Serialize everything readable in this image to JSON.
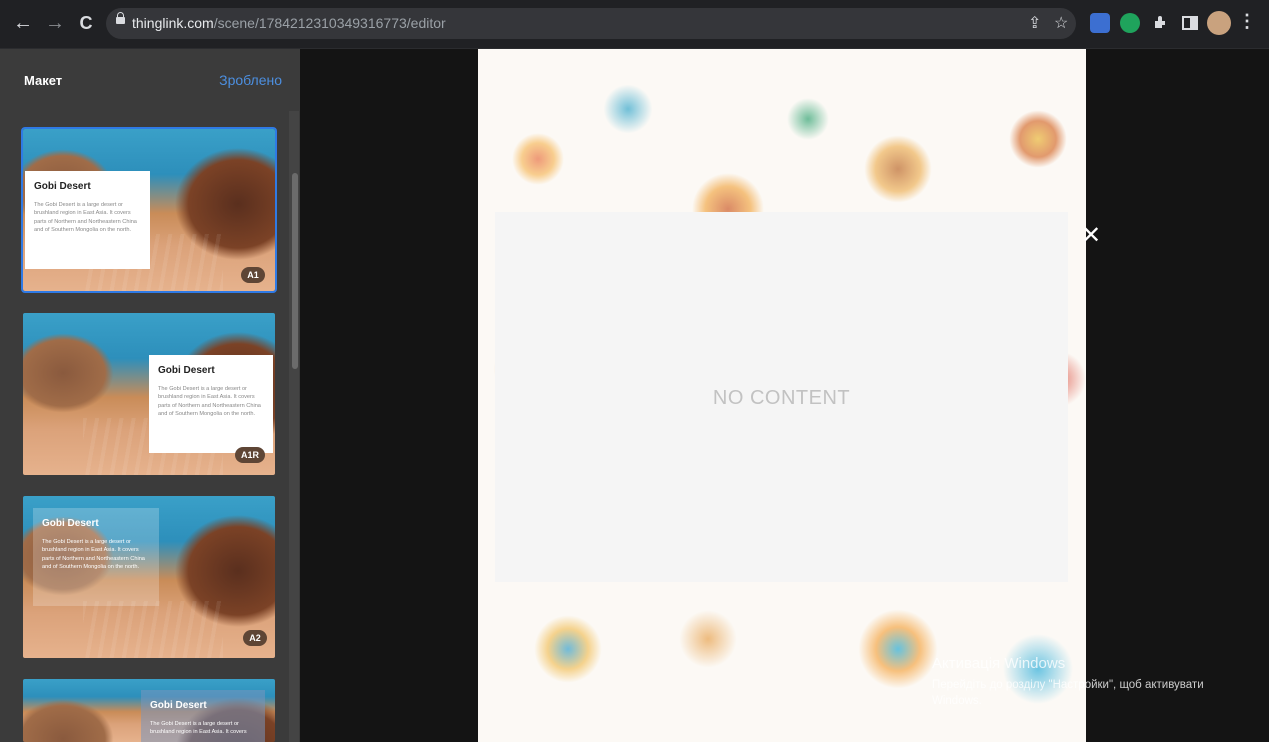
{
  "browser": {
    "url_domain": "thinglink.com",
    "url_path": "/scene/1784212310349316773/editor",
    "back_icon": "←",
    "forward_icon": "→",
    "reload_icon": "C",
    "share_icon": "⇪",
    "star_icon": "☆",
    "menu_icon": "⋮"
  },
  "sidebar": {
    "title": "Макет",
    "done_label": "Зроблено",
    "layouts": [
      {
        "title": "Gobi Desert",
        "description": "The Gobi Desert is a large desert or brushland region in East Asia. It covers parts of Northern and Northeastern China and of Southern Mongolia on the north.",
        "badge": "A1"
      },
      {
        "title": "Gobi Desert",
        "description": "The Gobi Desert is a large desert or brushland region in East Asia. It covers parts of Northern and Northeastern China and of Southern Mongolia on the north.",
        "badge": "A1R"
      },
      {
        "title": "Gobi Desert",
        "description": "The Gobi Desert is a large desert or brushland region in East Asia. It covers parts of Northern and Northeastern China and of Southern Mongolia on the north.",
        "badge": "A2"
      },
      {
        "title": "Gobi Desert",
        "description": "The Gobi Desert is a large desert or brushland region in East Asia. It covers",
        "badge": ""
      }
    ]
  },
  "modal": {
    "text": "NO CONTENT",
    "close_icon": "✕"
  },
  "watermark": {
    "title": "Активація Windows",
    "subtitle": "Перейдіть до розділу \"Настройки\", щоб активувати Windows."
  },
  "colors": {
    "accent": "#2f7ae5",
    "done_link": "#4c8fe0",
    "sidebar_bg": "#3b3b3b",
    "chrome_bg": "#202124"
  }
}
